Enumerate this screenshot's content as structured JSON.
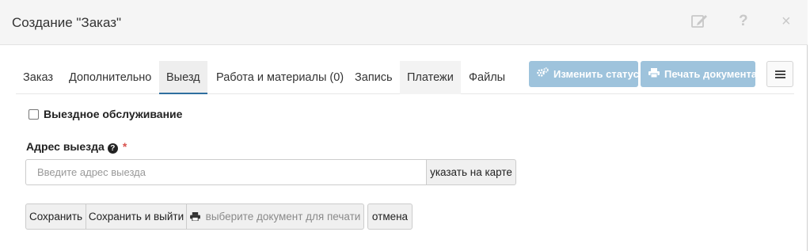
{
  "header": {
    "title": "Создание \"Заказ\"",
    "icons": [
      "edit-icon",
      "help-icon",
      "close-icon"
    ],
    "help_glyph": "?",
    "close_glyph": "×"
  },
  "tabs": [
    {
      "label": "Заказ",
      "active": false
    },
    {
      "label": "Дополнительно",
      "active": false
    },
    {
      "label": "Выезд",
      "active": true
    },
    {
      "label": "Работа и материалы (0)",
      "active": false
    },
    {
      "label": "Запись",
      "active": false
    },
    {
      "label": "Платежи",
      "active": false
    },
    {
      "label": "Файлы",
      "active": false
    }
  ],
  "toolbar": {
    "change_status_label": "Изменить статус",
    "print_document_label": "Печать документа",
    "accent_color": "#9ec3dc"
  },
  "form": {
    "onsite_service_label": "Выездное обслуживание",
    "onsite_service_checked": false,
    "address_label": "Адрес выезда",
    "required_mark": "*",
    "address_value": "",
    "address_placeholder": "Введите адрес выезда",
    "map_button_label": "указать на карте"
  },
  "actions": {
    "save_label": "Сохранить",
    "save_exit_label": "Сохранить и выйти",
    "print_select_label": "выберите документ для печати",
    "cancel_label": "отмена"
  }
}
